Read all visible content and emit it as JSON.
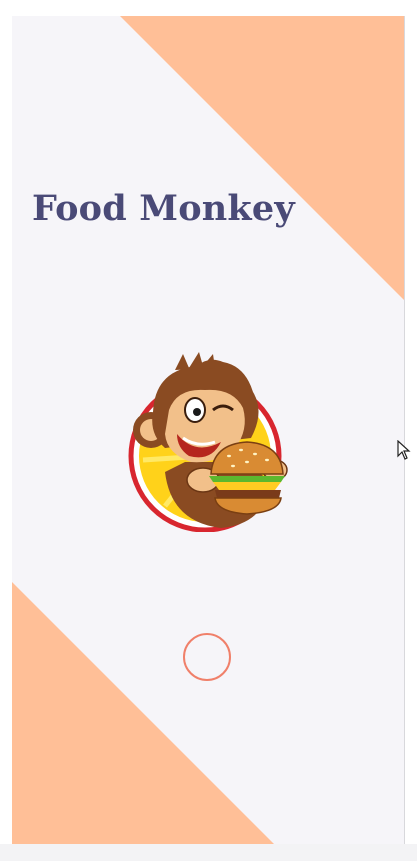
{
  "app": {
    "title": "Food Monkey"
  },
  "splash": {
    "logo_icon": "monkey-eating-burger-logo",
    "loader_icon": "loading-ring"
  },
  "colors": {
    "background": "#f6f5f9",
    "accent_peach": "#ffbf97",
    "title_text": "#4a4a77",
    "loader_ring": "#f0806a"
  }
}
